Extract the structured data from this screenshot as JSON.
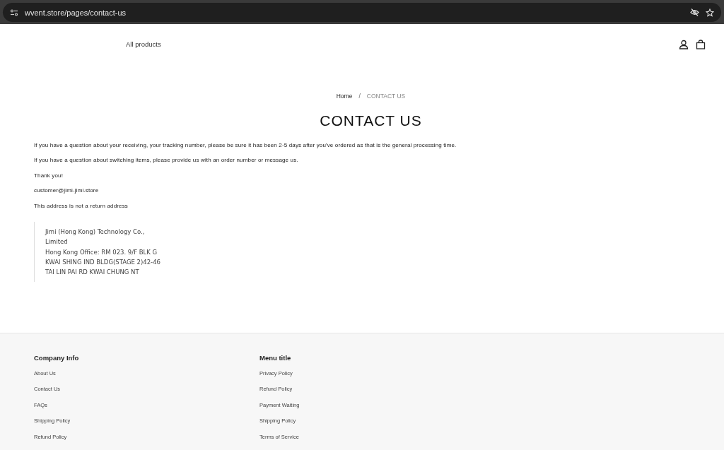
{
  "browser": {
    "url": "wvent.store/pages/contact-us"
  },
  "header": {
    "nav": [
      "All products"
    ]
  },
  "breadcrumb": {
    "items": [
      {
        "label": "Home",
        "selected": false
      },
      {
        "label": "CONTACT US",
        "selected": true
      }
    ],
    "separator": "/"
  },
  "page": {
    "title": "CONTACT US",
    "paragraphs": [
      "If you have a question about your receiving, your tracking number, please be sure it has been 2-5 days after you've ordered as that is the general processing time.",
      "If you have a question about switching items, please provide us with an order number or message us.",
      "Thank you!",
      "customer@jimi-jimi.store",
      "This address is not a return address"
    ],
    "address_lines": [
      "Jimi (Hong Kong) Technology Co.,",
      "Limited",
      "Hong Kong Office: RM 023. 9/F BLK G",
      "KWAI SHING IND BLDG(STAGE 2)42-46",
      "TAI LIN PAI RD KWAI CHUNG NT"
    ]
  },
  "footer": {
    "columns": [
      {
        "heading": "Company Info",
        "links": [
          "About Us",
          "Contact Us",
          "FAQs",
          "Shipping Policy",
          "Refund Policy"
        ]
      },
      {
        "heading": "Menu title",
        "links": [
          "Privacy Policy",
          "Refund Policy",
          "Payment Waiting",
          "Shipping Policy",
          "Terms of Service"
        ]
      }
    ]
  }
}
